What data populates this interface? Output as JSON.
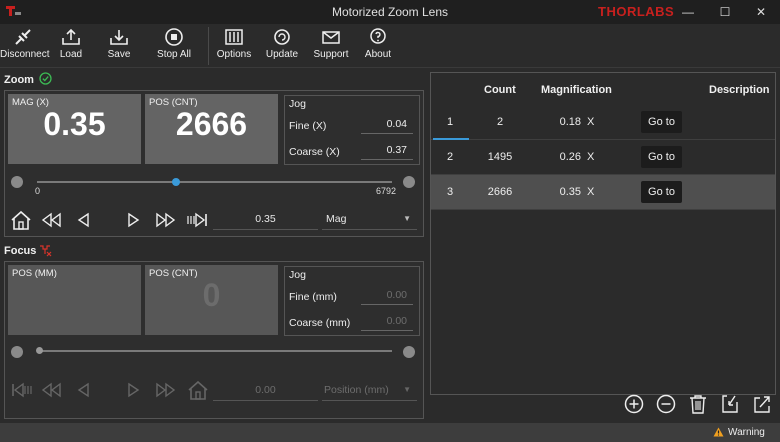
{
  "window": {
    "title": "Motorized Zoom Lens",
    "brand": "THORLABS"
  },
  "toolbar": {
    "items": [
      {
        "label": "Disconnect",
        "icon": "disconnect-icon"
      },
      {
        "label": "Load",
        "icon": "load-icon"
      },
      {
        "label": "Save",
        "icon": "save-icon"
      },
      {
        "label": "Stop All",
        "icon": "stop-icon"
      },
      {
        "label": "Options",
        "icon": "options-icon"
      },
      {
        "label": "Update",
        "icon": "update-icon"
      },
      {
        "label": "Support",
        "icon": "support-icon"
      },
      {
        "label": "About",
        "icon": "about-icon"
      }
    ]
  },
  "zoom": {
    "title": "Zoom",
    "mag_label": "MAG (X)",
    "mag_value": "0.35",
    "pos_label": "POS (CNT)",
    "pos_value": "2666",
    "jog": {
      "title": "Jog",
      "fine_label": "Fine  (X)",
      "fine_value": "0.04",
      "coarse_label": "Coarse  (X)",
      "coarse_value": "0.37"
    },
    "slider": {
      "min": "0",
      "max": "6792",
      "position": 0.3925
    },
    "target_value": "0.35",
    "mode": "Mag"
  },
  "focus": {
    "title": "Focus",
    "pos_mm_label": "POS (MM)",
    "pos_cnt_label": "POS (CNT)",
    "pos_cnt_value": "0",
    "jog": {
      "title": "Jog",
      "fine_label": "Fine  (mm)",
      "fine_value": "0.00",
      "coarse_label": "Coarse  (mm)",
      "coarse_value": "0.00"
    },
    "target_value": "0.00",
    "mode": "Position (mm)"
  },
  "presets": {
    "headers": {
      "count": "Count",
      "magnification": "Magnification",
      "description": "Description"
    },
    "rows": [
      {
        "index": "1",
        "count": "2",
        "mag": "0.18",
        "unit": "X",
        "action": "Go to"
      },
      {
        "index": "2",
        "count": "1495",
        "mag": "0.26",
        "unit": "X",
        "action": "Go to"
      },
      {
        "index": "3",
        "count": "2666",
        "mag": "0.35",
        "unit": "X",
        "action": "Go to"
      }
    ]
  },
  "status": {
    "warning": "Warning"
  },
  "colors": {
    "accent": "#3a9ad9",
    "brand": "#c8201e",
    "ok": "#3cba54",
    "error": "#d9342b",
    "warning": "#f0a020"
  }
}
